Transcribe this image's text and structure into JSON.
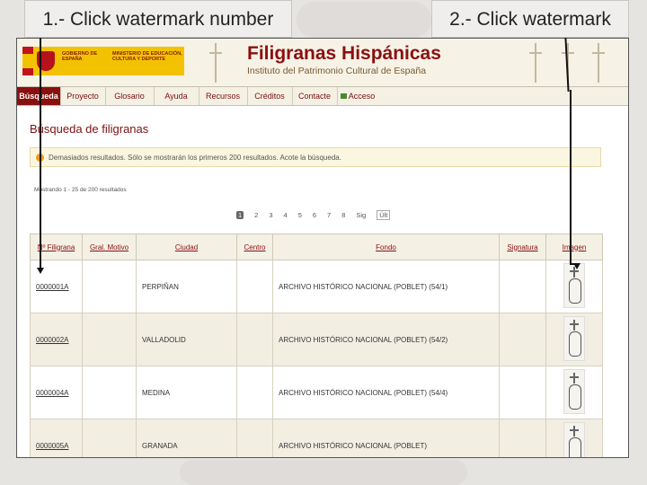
{
  "callouts": {
    "step1": "1.- Click watermark number",
    "step2": "2.- Click watermark"
  },
  "header": {
    "gov_line1": "GOBIERNO DE ESPAÑA",
    "gov_line2": "MINISTERIO DE EDUCACIÓN, CULTURA Y DEPORTE",
    "title": "Filigranas Hispánicas",
    "subtitle": "Instituto del Patrimonio Cultural de España"
  },
  "menu": {
    "items": [
      {
        "label": "Búsqueda",
        "active": true
      },
      {
        "label": "Proyecto"
      },
      {
        "label": "Glosario"
      },
      {
        "label": "Ayuda"
      },
      {
        "label": "Recursos"
      },
      {
        "label": "Créditos"
      },
      {
        "label": "Contacte"
      },
      {
        "label": "Acceso",
        "icon": "lock-icon"
      }
    ]
  },
  "main": {
    "title": "Búsqueda de filigranas",
    "alert": "Demasiados resultados. Sólo se mostrarán los primeros 200 resultados. Acote la búsqueda.",
    "count": "Mostrando 1 - 25 de 200 resultados",
    "pager": [
      "1",
      "2",
      "3",
      "4",
      "5",
      "6",
      "7",
      "8",
      "Sig",
      "Últ"
    ],
    "table": {
      "headers": [
        "Nº Filigrana",
        "Gral. Motivo",
        "Ciudad",
        "Centro",
        "Fondo",
        "Signatura",
        "Imagen"
      ],
      "rows": [
        {
          "id": "0000001A",
          "motivo": "",
          "ciudad": "PERPIÑAN",
          "centro": "",
          "fondo": "ARCHIVO HISTÓRICO NACIONAL (POBLET) (54/1)",
          "signatura": ""
        },
        {
          "id": "0000002A",
          "motivo": "",
          "ciudad": "VALLADOLID",
          "centro": "",
          "fondo": "ARCHIVO HISTÓRICO NACIONAL (POBLET) (54/2)",
          "signatura": ""
        },
        {
          "id": "0000004A",
          "motivo": "",
          "ciudad": "MEDINA",
          "centro": "",
          "fondo": "ARCHIVO HISTÓRICO NACIONAL (POBLET) (54/4)",
          "signatura": ""
        },
        {
          "id": "0000005A",
          "motivo": "",
          "ciudad": "GRANADA",
          "centro": "",
          "fondo": "ARCHIVO HISTÓRICO NACIONAL (POBLET)",
          "signatura": ""
        }
      ]
    }
  },
  "colors": {
    "accent": "#8a1010",
    "banner_bg": "#f6f2e6",
    "gov_yellow": "#f2c200",
    "alert_icon": "#f39a1b"
  }
}
